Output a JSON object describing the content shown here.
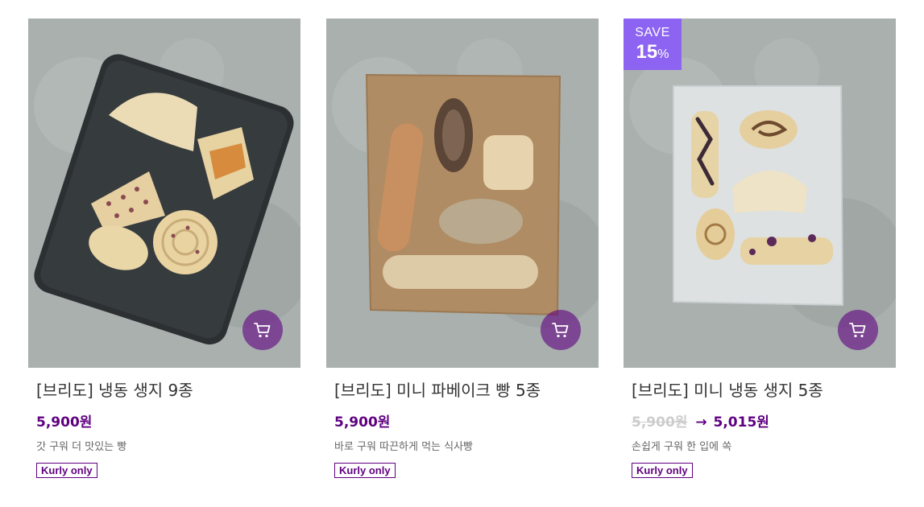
{
  "products": [
    {
      "name": "[브리도] 냉동 생지 9종",
      "price": "5,900원",
      "description": "갓 구워 더 맛있는 빵",
      "tag": "Kurly only",
      "cart_icon": "cart-icon"
    },
    {
      "name": "[브리도] 미니 파베이크 빵 5종",
      "price": "5,900원",
      "description": "바로 구워 따끈하게 먹는 식사빵",
      "tag": "Kurly only",
      "cart_icon": "cart-icon"
    },
    {
      "name": "[브리도] 미니 냉동 생지 5종",
      "original_price": "5,900원",
      "arrow": "→",
      "price": "5,015원",
      "description": "손쉽게 구워 한 입에 쏙",
      "tag": "Kurly only",
      "badge": {
        "label": "SAVE",
        "rate": "15",
        "unit": "%"
      },
      "cart_icon": "cart-icon"
    }
  ],
  "colors": {
    "brand": "#5f0080",
    "badge": "#8d63f2",
    "strikethrough": "#cccccc"
  }
}
